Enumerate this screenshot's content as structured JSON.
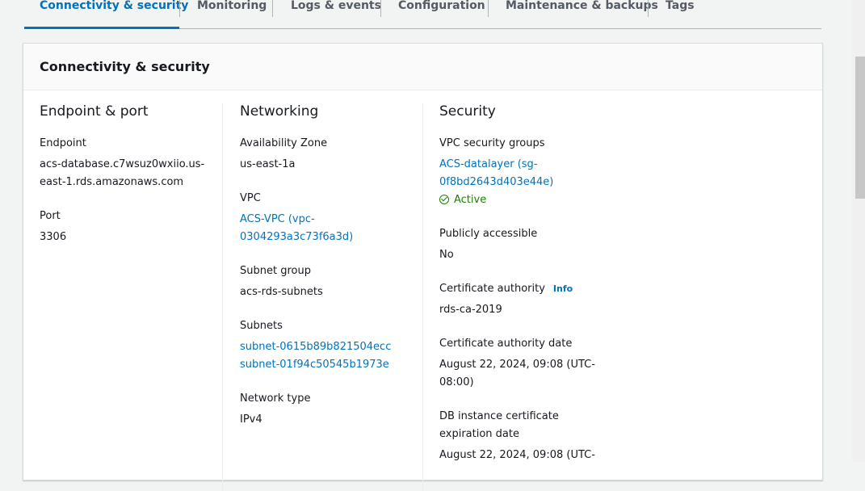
{
  "tabs": [
    {
      "label": "Connectivity & security",
      "active": true
    },
    {
      "label": "Monitoring"
    },
    {
      "label": "Logs & events"
    },
    {
      "label": "Configuration"
    },
    {
      "label": "Maintenance & backups"
    },
    {
      "label": "Tags"
    }
  ],
  "panel": {
    "title": "Connectivity & security",
    "endpoint_port": {
      "title": "Endpoint & port",
      "endpoint_label": "Endpoint",
      "endpoint_line1": "acs-database.c7wsuz0wxiio.us-",
      "endpoint_line2": "east-1.rds.amazonaws.com",
      "port_label": "Port",
      "port_value": "3306"
    },
    "networking": {
      "title": "Networking",
      "az_label": "Availability Zone",
      "az_value": "us-east-1a",
      "vpc_label": "VPC",
      "vpc_line1": "ACS-VPC (vpc-",
      "vpc_line2": "0304293a3c73f6a3d)",
      "subnet_group_label": "Subnet group",
      "subnet_group_value": "acs-rds-subnets",
      "subnets_label": "Subnets",
      "subnet_1": "subnet-0615b89b821504ecc",
      "subnet_2": "subnet-01f94c50545b1973e",
      "network_type_label": "Network type",
      "network_type_value": "IPv4"
    },
    "security": {
      "title": "Security",
      "sg_label": "VPC security groups",
      "sg_line1": "ACS-datalayer (sg-",
      "sg_line2": "0f8bd2643d403e44e)",
      "sg_status": "Active",
      "public_label": "Publicly accessible",
      "public_value": "No",
      "ca_label": "Certificate authority",
      "ca_info": "Info",
      "ca_value": "rds-ca-2019",
      "ca_date_label": "Certificate authority date",
      "ca_date_line1": "August 22, 2024, 09:08 (UTC-",
      "ca_date_line2": "08:00)",
      "db_cert_label_line1": "DB instance certificate",
      "db_cert_label_line2": "expiration date",
      "db_cert_value_line1": "August 22, 2024, 09:08 (UTC-"
    }
  },
  "colors": {
    "accent": "#0073bb",
    "success": "#1d8102"
  }
}
